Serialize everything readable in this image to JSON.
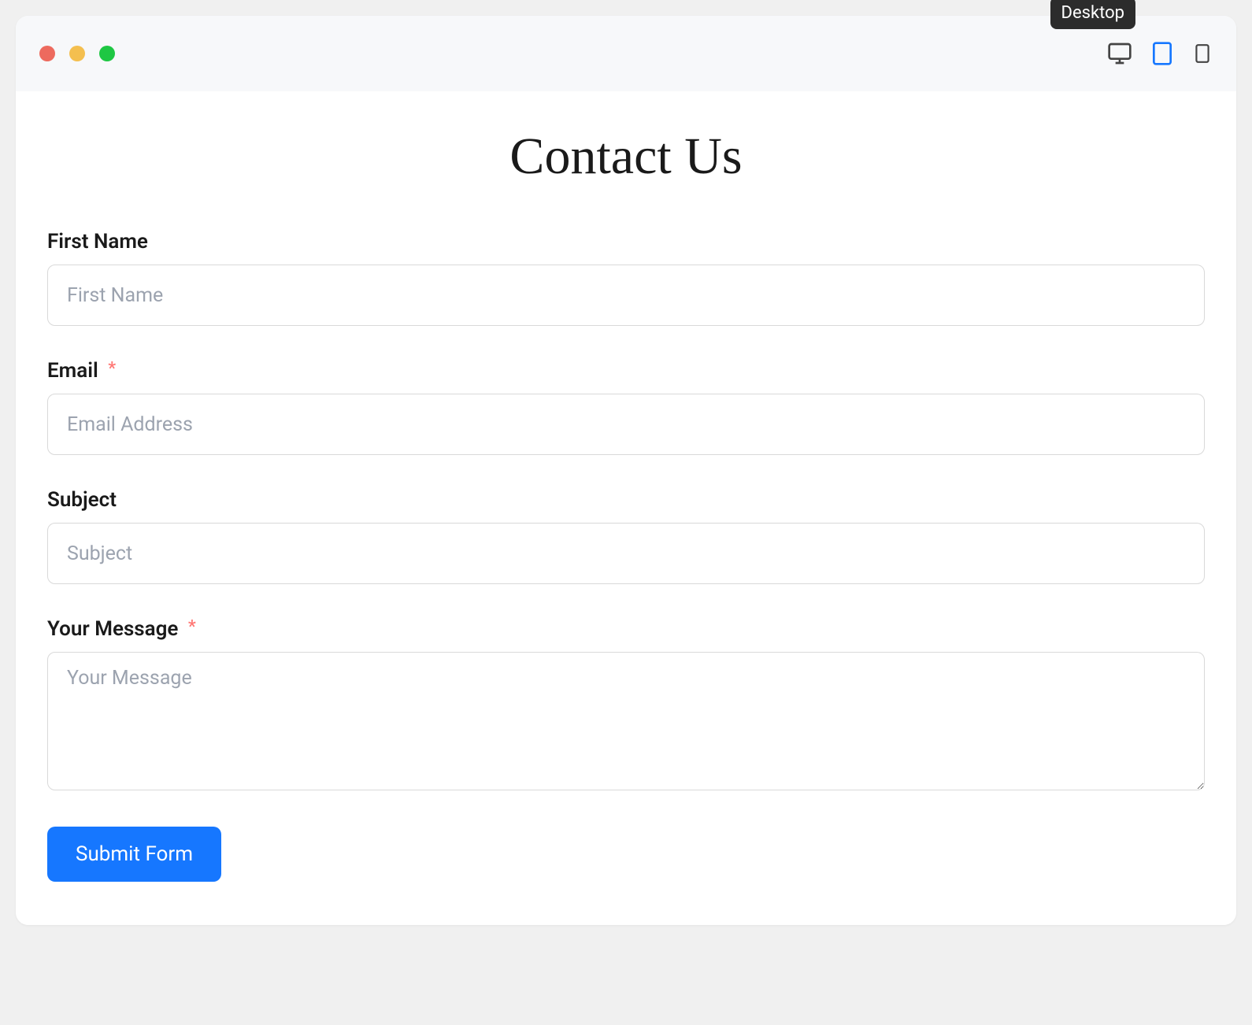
{
  "tooltip": {
    "label": "Desktop"
  },
  "page": {
    "title": "Contact Us"
  },
  "form": {
    "first_name": {
      "label": "First Name",
      "placeholder": "First Name",
      "required": false
    },
    "email": {
      "label": "Email",
      "placeholder": "Email Address",
      "required": true
    },
    "subject": {
      "label": "Subject",
      "placeholder": "Subject",
      "required": false
    },
    "message": {
      "label": "Your Message",
      "placeholder": "Your Message",
      "required": true
    },
    "submit_label": "Submit Form"
  },
  "required_marker": "*"
}
